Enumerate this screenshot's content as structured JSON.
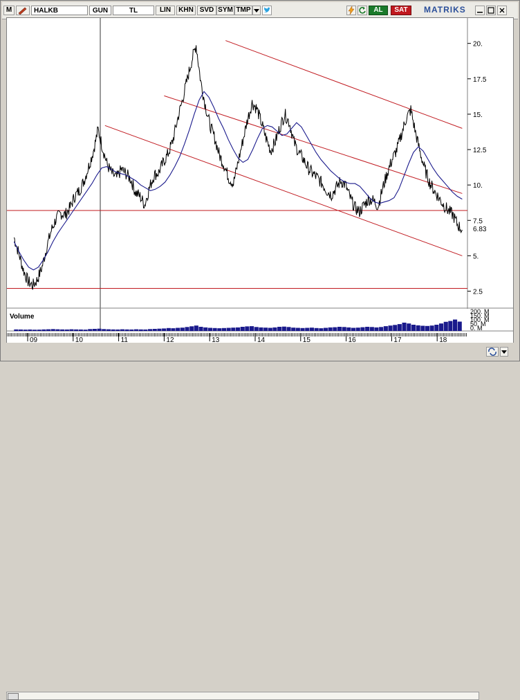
{
  "toolbar": {
    "corner_label": "M",
    "symbol": "HALKB",
    "period": "GUN",
    "currency": "TL",
    "scale": "LIN",
    "btn_khn": "KHN",
    "btn_svd": "SVD",
    "btn_sym": "SYM",
    "btn_tmp": "TMP",
    "buy_label": "AL",
    "sell_label": "SAT",
    "brand": "MATRIKS",
    "colors": {
      "buy": "#1a7a2a",
      "sell": "#c0181e",
      "brand": "#2b4f9a"
    }
  },
  "chart_data": {
    "type": "line",
    "title": "",
    "x_tick_labels": [
      "09",
      "10",
      "11",
      "12",
      "13",
      "14",
      "15",
      "16",
      "17",
      "18"
    ],
    "y_tick_labels": [
      "20.",
      "17.5",
      "15.",
      "12.5",
      "10.",
      "7.5",
      "5.",
      "2.5"
    ],
    "ylim": [
      1.5,
      21.5
    ],
    "last_value_label": "6.83",
    "series": [
      {
        "values": [
          6.3,
          5.2,
          4.0,
          3.2,
          2.9,
          3.3,
          4.2,
          5.6,
          6.8,
          7.6,
          8.0,
          7.9,
          8.4,
          9.2,
          9.6,
          10.3,
          11.3,
          12.4,
          13.9,
          12.6,
          11.4,
          10.8,
          10.5,
          11.1,
          10.8,
          10.4,
          9.5,
          9.2,
          8.6,
          9.8,
          10.7,
          10.9,
          11.6,
          12.2,
          13.1,
          14.6,
          15.9,
          17.3,
          18.7,
          19.9,
          17.3,
          15.6,
          14.2,
          13.3,
          12.1,
          11.4,
          10.5,
          10.1,
          11.6,
          13.1,
          14.6,
          15.8,
          15.4,
          14.4,
          13.3,
          12.4,
          13.1,
          14.1,
          15.0,
          14.4,
          13.0,
          12.3,
          11.8,
          11.2,
          10.8,
          10.5,
          10.1,
          9.6,
          9.3,
          9.8,
          10.3,
          10.0,
          9.1,
          8.4,
          8.1,
          8.6,
          9.0,
          8.9,
          8.5,
          9.8,
          10.9,
          11.8,
          12.5,
          13.6,
          14.7,
          15.3,
          13.7,
          12.3,
          11.1,
          10.2,
          9.6,
          9.1,
          8.6,
          8.2,
          7.9,
          7.2,
          6.83
        ]
      },
      {
        "values": [
          6.0,
          5.3,
          4.7,
          4.2,
          4.0,
          4.2,
          4.7,
          5.3,
          6.0,
          6.6,
          7.1,
          7.6,
          8.1,
          8.6,
          9.1,
          9.6,
          10.1,
          10.7,
          11.2,
          11.3,
          11.1,
          10.9,
          10.8,
          10.7,
          10.5,
          10.3,
          10.0,
          9.8,
          9.6,
          9.7,
          9.9,
          10.2,
          10.7,
          11.3,
          12.0,
          12.9,
          13.9,
          15.0,
          16.0,
          16.6,
          16.2,
          15.5,
          14.7,
          14.0,
          13.2,
          12.5,
          11.9,
          11.6,
          11.8,
          12.5,
          13.3,
          14.0,
          14.2,
          14.1,
          13.8,
          13.5,
          13.6,
          14.0,
          14.4,
          14.1,
          13.5,
          12.9,
          12.3,
          11.8,
          11.4,
          11.0,
          10.7,
          10.4,
          10.2,
          10.1,
          10.1,
          9.9,
          9.5,
          9.1,
          8.8,
          8.7,
          8.8,
          8.9,
          9.1,
          9.7,
          10.6,
          11.5,
          12.3,
          12.7,
          12.4,
          11.8,
          11.2,
          10.7,
          10.3,
          9.9,
          9.5,
          9.2,
          9.0
        ]
      }
    ],
    "horizontal_lines": [
      8.2,
      2.7
    ],
    "channels": [
      {
        "upper": [
          [
            13.35,
            20.2
          ],
          [
            18.55,
            14.0
          ]
        ],
        "lower": [
          [
            10.7,
            14.2
          ],
          [
            18.55,
            5.0
          ]
        ],
        "middle": [
          [
            12.0,
            16.3
          ],
          [
            18.55,
            9.4
          ]
        ]
      }
    ],
    "volume": {
      "label": "Volume",
      "tick_labels": [
        "200. M",
        "150. M",
        "100. M",
        "50. M",
        "0. M"
      ],
      "ylim": [
        0,
        200
      ],
      "values": [
        15,
        14,
        13,
        14,
        12,
        13,
        15,
        16,
        18,
        16,
        15,
        14,
        16,
        15,
        14,
        13,
        18,
        20,
        22,
        18,
        16,
        15,
        14,
        16,
        15,
        14,
        16,
        15,
        14,
        18,
        20,
        22,
        24,
        28,
        26,
        30,
        32,
        38,
        45,
        52,
        40,
        34,
        30,
        28,
        26,
        28,
        30,
        32,
        34,
        40,
        44,
        46,
        38,
        34,
        32,
        30,
        34,
        40,
        42,
        38,
        32,
        30,
        28,
        30,
        32,
        28,
        26,
        30,
        34,
        36,
        40,
        38,
        34,
        30,
        32,
        36,
        40,
        38,
        34,
        38,
        46,
        52,
        58,
        66,
        80,
        72,
        60,
        54,
        50,
        48,
        52,
        60,
        72,
        88,
        96,
        110,
        90
      ]
    },
    "colors": {
      "price": "#000000",
      "average": "#1a1a8c",
      "lines": "#c0181e",
      "volume": "#1a1a8c"
    }
  }
}
